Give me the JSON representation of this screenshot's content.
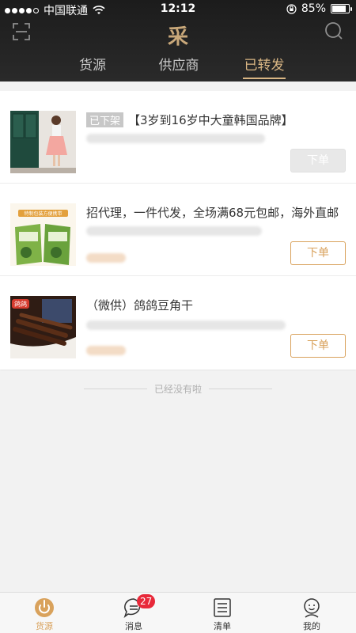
{
  "status": {
    "carrier": "中国联通",
    "time": "12:12",
    "battery": "85%",
    "battery_level": 0.85
  },
  "header": {
    "logo": "采",
    "tabs": [
      {
        "label": "货源"
      },
      {
        "label": "供应商"
      },
      {
        "label": "已转发"
      }
    ],
    "active_tab": "已转发"
  },
  "items": [
    {
      "status_tag": "已下架",
      "title": "【3岁到16岁中大童韩国品牌】",
      "button": "下单",
      "button_state": "disabled"
    },
    {
      "status_tag": "",
      "title": "招代理，一件代发，全场满68元包邮，海外直邮",
      "button": "下单",
      "button_state": "enabled",
      "thumb_caption": "特制包装方便携带"
    },
    {
      "status_tag": "",
      "title": "（微供）鸽鸽豆角干",
      "button": "下单",
      "button_state": "enabled",
      "thumb_badge": "鸽鸽"
    }
  ],
  "end_text": "已经没有啦",
  "nav": [
    {
      "label": "货源",
      "icon": "source-icon",
      "active": true
    },
    {
      "label": "消息",
      "icon": "message-icon",
      "badge": "27"
    },
    {
      "label": "清单",
      "icon": "list-icon"
    },
    {
      "label": "我的",
      "icon": "profile-icon"
    }
  ],
  "colors": {
    "accent": "#d9a25c",
    "header_bg": "#222222",
    "badge": "#e8293a"
  }
}
